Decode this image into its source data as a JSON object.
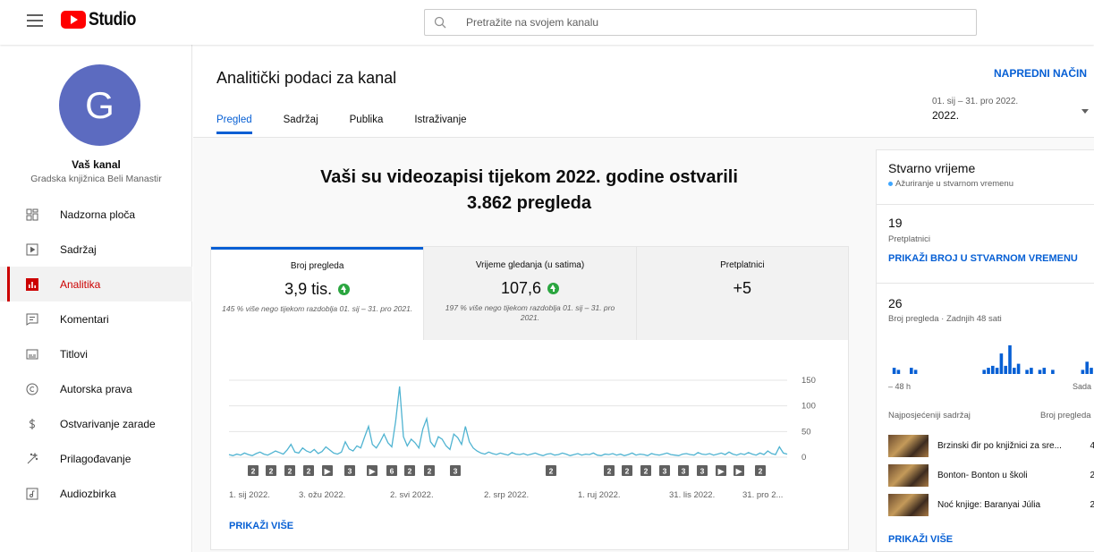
{
  "app": {
    "logo_text": "Studio",
    "brand_color": "#ff0000",
    "accent": "#065fd4"
  },
  "search": {
    "placeholder": "Pretražite na svojem kanalu"
  },
  "channel": {
    "avatar_letter": "G",
    "title": "Vaš kanal",
    "subtitle": "Gradska knjižnica Beli Manastir",
    "avatar_color": "#5c6bc0"
  },
  "sidebar": {
    "items": [
      {
        "label": "Nadzorna ploča",
        "icon": "dashboard-icon"
      },
      {
        "label": "Sadržaj",
        "icon": "content-icon"
      },
      {
        "label": "Analitika",
        "icon": "analytics-icon",
        "active": true
      },
      {
        "label": "Komentari",
        "icon": "comments-icon"
      },
      {
        "label": "Titlovi",
        "icon": "subtitles-icon"
      },
      {
        "label": "Autorska prava",
        "icon": "copyright-icon"
      },
      {
        "label": "Ostvarivanje zarade",
        "icon": "monetization-icon"
      },
      {
        "label": "Prilagođavanje",
        "icon": "customization-icon"
      },
      {
        "label": "Audiozbirka",
        "icon": "audio-library-icon"
      }
    ]
  },
  "header": {
    "title": "Analitički podaci za kanal",
    "advanced_mode": "NAPREDNI NAČIN",
    "tabs": [
      {
        "label": "Pregled",
        "active": true
      },
      {
        "label": "Sadržaj"
      },
      {
        "label": "Publika"
      },
      {
        "label": "Istraživanje"
      }
    ],
    "date_range": {
      "range": "01. sij – 31. pro 2022.",
      "label": "2022."
    }
  },
  "overview": {
    "headline_line1": "Vaši su videozapisi tijekom 2022. godine ostvarili",
    "headline_line2": "3.862 pregleda",
    "metrics": [
      {
        "title": "Broj pregleda",
        "value": "3,9 tis.",
        "trend": "up",
        "desc": "145 % više nego tijekom razdoblja 01. sij – 31. pro 2021."
      },
      {
        "title": "Vrijeme gledanja (u satima)",
        "value": "107,6",
        "trend": "up",
        "desc": "197 % više nego tijekom razdoblja 01. sij – 31. pro 2021."
      },
      {
        "title": "Pretplatnici",
        "value": "+5",
        "trend": "",
        "desc": ""
      }
    ],
    "show_more": "PRIKAŽI VIŠE"
  },
  "chart_data": {
    "type": "line",
    "title": "",
    "xlabel": "",
    "ylabel": "",
    "ylim": [
      0,
      150
    ],
    "yticks": [
      "150",
      "100",
      "50",
      "0"
    ],
    "xtick_labels": [
      "1. sij 2022.",
      "3. ožu 2022.",
      "2. svi 2022.",
      "2. srp 2022.",
      "1. ruj 2022.",
      "31. lis 2022.",
      "31. pro 2..."
    ],
    "series": [
      {
        "color": "#4fb3d1",
        "values": [
          5,
          3,
          6,
          4,
          8,
          5,
          3,
          7,
          10,
          6,
          4,
          8,
          12,
          9,
          6,
          14,
          25,
          10,
          8,
          18,
          12,
          9,
          15,
          7,
          11,
          20,
          14,
          8,
          6,
          10,
          30,
          16,
          12,
          22,
          18,
          40,
          60,
          25,
          18,
          30,
          45,
          28,
          20,
          70,
          138,
          40,
          22,
          35,
          28,
          18,
          55,
          75,
          30,
          20,
          40,
          35,
          22,
          15,
          45,
          38,
          25,
          60,
          30,
          18,
          12,
          8,
          6,
          10,
          7,
          5,
          8,
          6,
          4,
          9,
          6,
          5,
          7,
          4,
          6,
          8,
          5,
          3,
          6,
          7,
          4,
          5,
          8,
          6,
          3,
          5,
          7,
          4,
          6,
          5,
          8,
          4,
          3,
          6,
          5,
          7,
          4,
          6,
          3,
          5,
          8,
          4,
          6,
          5,
          3,
          7,
          5,
          4,
          6,
          8,
          5,
          4,
          3,
          6,
          7,
          5,
          4,
          9,
          6,
          5,
          7,
          4,
          6,
          8,
          5,
          10,
          6,
          4,
          7,
          5,
          9,
          6,
          4,
          8,
          5,
          12,
          7,
          5,
          20,
          8,
          6
        ]
      }
    ],
    "markers": [
      "2",
      "2",
      "2",
      "2",
      "▶",
      "3",
      "▶",
      "6",
      "2",
      "2",
      "3",
      "2",
      "2",
      "2",
      "2",
      "3",
      "3",
      "3",
      "▶",
      "▶",
      "2"
    ]
  },
  "realtime": {
    "title": "Stvarno vrijeme",
    "live_text": "Ažuriranje u stvarnom vremenu",
    "subscribers_value": "19",
    "subscribers_label": "Pretplatnici",
    "show_live_count": "PRIKAŽI BROJ U STVARNOM VREMENU",
    "views_value": "26",
    "views_label": "Broj pregleda · Zadnjih 48 sati",
    "hourly_views": [
      0,
      3,
      2,
      0,
      0,
      3,
      2,
      0,
      0,
      0,
      0,
      0,
      0,
      0,
      0,
      0,
      0,
      0,
      0,
      0,
      0,
      0,
      2,
      3,
      4,
      3,
      10,
      4,
      14,
      3,
      5,
      0,
      2,
      3,
      0,
      2,
      3,
      0,
      2,
      0,
      0,
      0,
      0,
      0,
      0,
      2,
      6,
      3
    ],
    "axis_left": "– 48 h",
    "axis_right": "Sada",
    "list_header_left": "Najposjećeniji sadržaj",
    "list_header_right": "Broj pregleda",
    "videos": [
      {
        "title": "Brzinski đir po knjižnici za sre...",
        "views": "4"
      },
      {
        "title": "Bonton- Bonton u školi",
        "views": "2"
      },
      {
        "title": "Noć knjige: Baranyai Júlia",
        "views": "2"
      }
    ],
    "show_more": "PRIKAŽI VIŠE"
  }
}
